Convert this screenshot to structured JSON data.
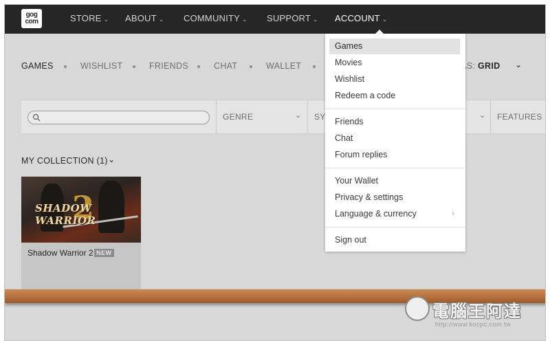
{
  "nav": {
    "logo_line1": "gog",
    "logo_line2": "com",
    "store": "STORE",
    "about": "ABOUT",
    "community": "COMMUNITY",
    "support": "SUPPORT",
    "account": "ACCOUNT"
  },
  "subnav": {
    "tabs": [
      "GAMES",
      "WISHLIST",
      "FRIENDS",
      "CHAT",
      "WALLET"
    ],
    "view_as_label": "W AS:",
    "view_as_value": "GRID"
  },
  "filters": {
    "search_placeholder": "",
    "genre": "GENRE",
    "system": "SYS",
    "features": "FEATURES"
  },
  "collection": {
    "title": "MY COLLECTION (1)",
    "games": [
      {
        "name": "Shadow Warrior 2",
        "badge": "NEW",
        "cover_title": "SHADOW WARRIOR",
        "cover_number": "2"
      }
    ]
  },
  "account_menu": {
    "group1": [
      "Games",
      "Movies",
      "Wishlist",
      "Redeem a code"
    ],
    "group2": [
      "Friends",
      "Chat",
      "Forum replies"
    ],
    "group3": [
      "Your Wallet",
      "Privacy & settings",
      "Language & currency"
    ],
    "group4": [
      "Sign out"
    ]
  },
  "watermark": {
    "text": "電腦王阿達",
    "url": "http://www.kocpc.com.tw"
  },
  "colors": {
    "topbar": "#262626",
    "page_bg": "#d8d8d8",
    "menu_hover": "#e2e2e2",
    "shelf": "#b87440"
  }
}
